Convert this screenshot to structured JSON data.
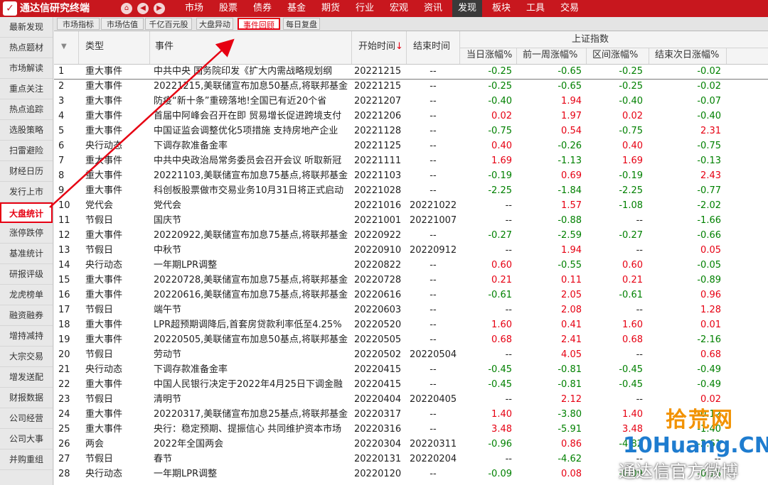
{
  "app": {
    "title": "通达信研究终端",
    "logo_glyph": "✓"
  },
  "topnav": {
    "buttons": [
      "⌂",
      "◀",
      "▶"
    ],
    "menu": [
      "市场",
      "股票",
      "债券",
      "基金",
      "期货",
      "行业",
      "宏观",
      "资讯",
      "发现",
      "板块",
      "工具",
      "交易"
    ],
    "active_menu": "发现"
  },
  "sidebar": {
    "items": [
      "最新发现",
      "热点题材",
      "市场解读",
      "重点关注",
      "热点追踪",
      "选股策略",
      "扫雷避险",
      "财经日历",
      "发行上市",
      "大盘统计",
      "涨停跌停",
      "基准统计",
      "研报评级",
      "龙虎榜单",
      "融资融券",
      "增持减持",
      "大宗交易",
      "增发送配",
      "财报数据",
      "公司经营",
      "公司大事",
      "并购重组"
    ],
    "active": "大盘统计"
  },
  "subtabs": {
    "items": [
      "市场指标",
      "市场估值",
      "千亿百元股",
      "大盘异动",
      "事件回顾",
      "每日复盘"
    ],
    "active": "事件回顾"
  },
  "table": {
    "headers": {
      "sort": "▼",
      "type": "类型",
      "event": "事件",
      "start": "开始时间",
      "sort_arrow": "↓",
      "end": "结束时间",
      "group": "上证指数",
      "day_chg": "当日涨幅%",
      "week_chg": "前一周涨幅%",
      "range_chg": "区间涨幅%",
      "next_chg": "结束次日涨幅%"
    },
    "rows": [
      [
        "1",
        "重大事件",
        "中共中央 国务院印发《扩大内需战略规划纲",
        "20221215",
        "--",
        "-0.25",
        "-0.65",
        "-0.25",
        "-0.02"
      ],
      [
        "2",
        "重大事件",
        "20221215,美联储宣布加息50基点,将联邦基金",
        "20221215",
        "--",
        "-0.25",
        "-0.65",
        "-0.25",
        "-0.02"
      ],
      [
        "3",
        "重大事件",
        "防疫“新十条”重磅落地!全国已有近20个省",
        "20221207",
        "--",
        "-0.40",
        "1.94",
        "-0.40",
        "-0.07"
      ],
      [
        "4",
        "重大事件",
        "首届中阿峰会召开在即 贸易增长促进跨境支付",
        "20221206",
        "--",
        "0.02",
        "1.97",
        "0.02",
        "-0.40"
      ],
      [
        "5",
        "重大事件",
        "中国证监会调整优化5项措施 支持房地产企业",
        "20221128",
        "--",
        "-0.75",
        "0.54",
        "-0.75",
        "2.31"
      ],
      [
        "6",
        "央行动态",
        "下调存款准备金率",
        "20221125",
        "--",
        "0.40",
        "-0.26",
        "0.40",
        "-0.75"
      ],
      [
        "7",
        "重大事件",
        "中共中央政治局常务委员会召开会议 听取新冠",
        "20221111",
        "--",
        "1.69",
        "-1.13",
        "1.69",
        "-0.13"
      ],
      [
        "8",
        "重大事件",
        "20221103,美联储宣布加息75基点,将联邦基金",
        "20221103",
        "--",
        "-0.19",
        "0.69",
        "-0.19",
        "2.43"
      ],
      [
        "9",
        "重大事件",
        "科创板股票做市交易业务10月31日将正式启动",
        "20221028",
        "--",
        "-2.25",
        "-1.84",
        "-2.25",
        "-0.77"
      ],
      [
        "10",
        "党代会",
        "党代会",
        "20221016",
        "20221022",
        "--",
        "1.57",
        "-1.08",
        "-2.02"
      ],
      [
        "11",
        "节假日",
        "国庆节",
        "20221001",
        "20221007",
        "--",
        "-0.88",
        "--",
        "-1.66"
      ],
      [
        "12",
        "重大事件",
        "20220922,美联储宣布加息75基点,将联邦基金",
        "20220922",
        "--",
        "-0.27",
        "-2.59",
        "-0.27",
        "-0.66"
      ],
      [
        "13",
        "节假日",
        "中秋节",
        "20220910",
        "20220912",
        "--",
        "1.94",
        "--",
        "0.05"
      ],
      [
        "14",
        "央行动态",
        "一年期LPR调整",
        "20220822",
        "--",
        "0.60",
        "-0.55",
        "0.60",
        "-0.05"
      ],
      [
        "15",
        "重大事件",
        "20220728,美联储宣布加息75基点,将联邦基金",
        "20220728",
        "--",
        "0.21",
        "0.11",
        "0.21",
        "-0.89"
      ],
      [
        "16",
        "重大事件",
        "20220616,美联储宣布加息75基点,将联邦基金",
        "20220616",
        "--",
        "-0.61",
        "2.05",
        "-0.61",
        "0.96"
      ],
      [
        "17",
        "节假日",
        "端午节",
        "20220603",
        "--",
        "--",
        "2.08",
        "--",
        "1.28"
      ],
      [
        "18",
        "重大事件",
        "LPR超预期调降后,首套房贷款利率低至4.25%",
        "20220520",
        "--",
        "1.60",
        "0.41",
        "1.60",
        "0.01"
      ],
      [
        "19",
        "重大事件",
        "20220505,美联储宣布加息50基点,将联邦基金",
        "20220505",
        "--",
        "0.68",
        "2.41",
        "0.68",
        "-2.16"
      ],
      [
        "20",
        "节假日",
        "劳动节",
        "20220502",
        "20220504",
        "--",
        "4.05",
        "--",
        "0.68"
      ],
      [
        "21",
        "央行动态",
        "下调存款准备金率",
        "20220415",
        "--",
        "-0.45",
        "-0.81",
        "-0.45",
        "-0.49"
      ],
      [
        "22",
        "重大事件",
        "中国人民银行决定于2022年4月25日下调金融",
        "20220415",
        "--",
        "-0.45",
        "-0.81",
        "-0.45",
        "-0.49"
      ],
      [
        "23",
        "节假日",
        "清明节",
        "20220404",
        "20220405",
        "--",
        "2.12",
        "--",
        "0.02"
      ],
      [
        "24",
        "重大事件",
        "20220317,美联储宣布加息25基点,将联邦基金",
        "20220317",
        "--",
        "1.40",
        "-3.80",
        "1.40",
        "-0.12"
      ],
      [
        "25",
        "重大事件",
        "央行：稳定预期、提振信心 共同维护资本市场",
        "20220316",
        "--",
        "3.48",
        "-5.91",
        "3.48",
        "-1.40"
      ],
      [
        "26",
        "两会",
        "2022年全国两会",
        "20220304",
        "20220311",
        "-0.96",
        "0.86",
        "-4.82",
        "-2.61"
      ],
      [
        "27",
        "节假日",
        "春节",
        "20220131",
        "20220204",
        "--",
        "-4.62",
        "--",
        "--"
      ],
      [
        "28",
        "央行动态",
        "一年期LPR调整",
        "20220120",
        "--",
        "-0.09",
        "0.08",
        "-0.09",
        "-0.16"
      ]
    ]
  },
  "watermark": {
    "brand": "拾荒网",
    "domain": "10Huang.CN",
    "weibo": "通达信官方微博"
  },
  "colors": {
    "menu_bg": "#c8171e",
    "highlight": "#e60012",
    "up": "#e60012",
    "down": "#008000"
  }
}
